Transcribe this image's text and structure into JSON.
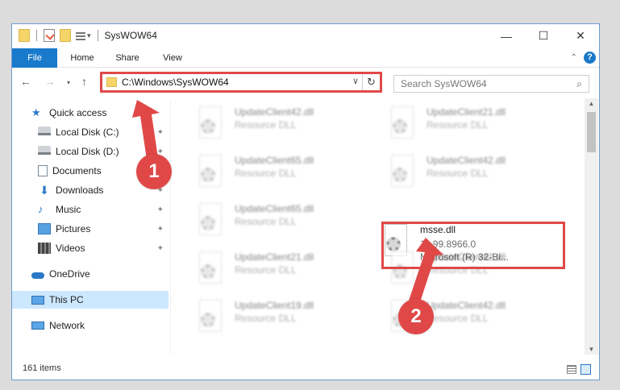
{
  "window": {
    "title": "SysWOW64"
  },
  "ribbon": {
    "tabs": [
      "File",
      "Home",
      "Share",
      "View"
    ]
  },
  "address": {
    "path": "C:\\Windows\\SysWOW64"
  },
  "search": {
    "placeholder": "Search SysWOW64"
  },
  "sidebar": {
    "quick_access": "Quick access",
    "items": [
      {
        "label": "Local Disk (C:)",
        "icon": "disk-icon",
        "pinned": true
      },
      {
        "label": "Local Disk (D:)",
        "icon": "disk-icon",
        "pinned": true
      },
      {
        "label": "Documents",
        "icon": "documents-icon",
        "pinned": true
      },
      {
        "label": "Downloads",
        "icon": "download-icon",
        "pinned": true
      },
      {
        "label": "Music",
        "icon": "music-icon",
        "pinned": true
      },
      {
        "label": "Pictures",
        "icon": "pictures-icon",
        "pinned": true
      },
      {
        "label": "Videos",
        "icon": "videos-icon",
        "pinned": true
      }
    ],
    "onedrive": "OneDrive",
    "this_pc": "This PC",
    "network": "Network"
  },
  "files": [
    {
      "name": "UpdateClient42.dll",
      "type": "Resource DLL"
    },
    {
      "name": "UpdateClient21.dll",
      "type": "Resource DLL"
    },
    {
      "name": "UpdateClient65.dll",
      "type": "Resource DLL"
    },
    {
      "name": "UpdateClient42.dll",
      "type": "Resource DLL"
    },
    {
      "name": "UpdateClient65.dll",
      "type": "Resource DLL"
    },
    {
      "name": "msse.dll",
      "type": "11.99.8966.0",
      "desc": "Microsoft (R) 32-Bi..."
    },
    {
      "name": "UpdateClient21.dll",
      "type": "Resource DLL"
    },
    {
      "name": "UpdateClient42.dll",
      "type": "Resource DLL"
    },
    {
      "name": "UpdateClient19.dll",
      "type": "Resource DLL"
    },
    {
      "name": "UpdateClient42.dll",
      "type": "Resource DLL"
    }
  ],
  "status": {
    "item_count": "161 items"
  },
  "annotations": {
    "step1": "1",
    "step2": "2"
  },
  "colors": {
    "accent": "#1979ca",
    "highlight": "#e04848",
    "selected": "#cce8ff"
  }
}
